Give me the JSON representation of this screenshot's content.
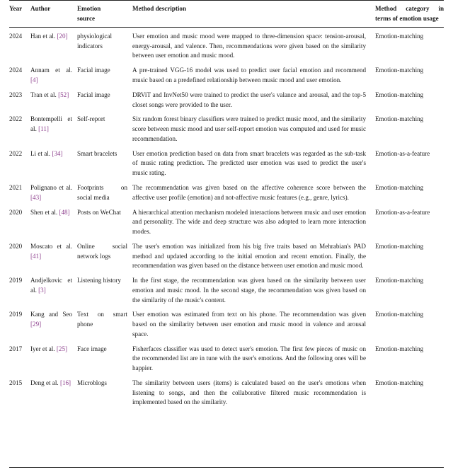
{
  "table": {
    "columns": [
      {
        "key": "year",
        "label": "Year"
      },
      {
        "key": "author",
        "label": "Author"
      },
      {
        "key": "source",
        "label": "Emotion source"
      },
      {
        "key": "method",
        "label": "Method description"
      },
      {
        "key": "category",
        "label": "Method category in terms of emotion usage"
      }
    ],
    "header": {
      "year": "Year",
      "author": "Author",
      "source_line1": "Emotion",
      "source_line2": "source",
      "method": "Method description",
      "category": "Method category in terms of emotion usage"
    },
    "citation_color": "#8d3f8d",
    "rule_color": "#222222",
    "rows": [
      {
        "year": "2024",
        "author_name": "Han et al.",
        "citation": "[20]",
        "cite_num": "20",
        "source": "physiological indicators",
        "method": "User emotion and music mood were mapped to three-dimension space: tension-arousal, energy-arousal, and valence. Then, recommendations were given based on the similarity between user emotion and music mood.",
        "category": "Emotion-matching"
      },
      {
        "year": "2024",
        "author_name": "Annam et al.",
        "citation": "[4]",
        "cite_num": "4",
        "source": "Facial image",
        "method": "A pre-trained VGG-16 model was used to predict user facial emotion and recommend music based on a predefined relationship between music mood and user emotion.",
        "category": "Emotion-matching"
      },
      {
        "year": "2023",
        "author_name": "Tran et al.",
        "citation": "[52]",
        "cite_num": "52",
        "source": "Facial image",
        "method": "DRViT and InvNet50 were trained to predict the user's valance and arousal, and the top-5 closet songs were provided to the user.",
        "category": "Emotion-matching"
      },
      {
        "year": "2022",
        "author_name": "Bontempelli et al.",
        "citation": "[11]",
        "cite_num": "11",
        "source": "Self-report",
        "method": "Six random forest binary classifiers were trained to predict music mood, and the similarity score between music mood and user self-report emotion was computed and used for music recommendation.",
        "category": "Emotion-matching"
      },
      {
        "year": "2022",
        "author_name": "Li et al.",
        "citation": "[34]",
        "cite_num": "34",
        "source": "Smart bracelets",
        "method": "User emotion prediction based on data from smart bracelets was regarded as the sub-task of music rating prediction. The predicted user emotion was used to predict the user's music rating.",
        "category": "Emotion-as-a-feature"
      },
      {
        "year": "2021",
        "author_name": "Polignano et al.",
        "citation": "[43]",
        "cite_num": "43",
        "source": "Footprints on social media",
        "method": "The recommendation was given based on the affective coherence score between the affective user profile (emotion) and not-affective music features (e.g., genre, lyrics).",
        "category": "Emotion-matching"
      },
      {
        "year": "2020",
        "author_name": "Shen et al.",
        "citation": "[48]",
        "cite_num": "48",
        "source": "Posts on WeChat",
        "method": "A hierarchical attention mechanism modeled interactions between music and user emotion and personality. The wide and deep structure was also adopted to learn more interaction modes.",
        "category": "Emotion-as-a-feature"
      },
      {
        "year": "2020",
        "author_name": "Moscato et al.",
        "citation": "[41]",
        "cite_num": "41",
        "source": "Online social network logs",
        "method": "The user's emotion was initialized from his big five traits based on Mehrabian's PAD method and updated according to the initial emotion and recent emotion. Finally, the recommendation was given based on the distance between user emotion and music mood.",
        "category": "Emotion-matching"
      },
      {
        "year": "2019",
        "author_name": "Andjelkovic et al.",
        "citation": "[3]",
        "cite_num": "3",
        "source": "Listening history",
        "method": "In the first stage, the recommendation was given based on the similarity between user emotion and music mood. In the second stage, the recommendation was given based on the similarity of the music's content.",
        "category": "Emotion-matching"
      },
      {
        "year": "2019",
        "author_name": "Kang and Seo",
        "citation": "[29]",
        "cite_num": "29",
        "source": "Text on smart phone",
        "method": "User emotion was estimated from text on his phone. The recommendation was given based on the similarity between user emotion and music mood in valence and arousal space.",
        "category": "Emotion-matching"
      },
      {
        "year": "2017",
        "author_name": "Iyer et al.",
        "citation": "[25]",
        "cite_num": "25",
        "source": "Face image",
        "method": "Fisherfaces classifier was used to detect user's emotion. The first few pieces of music on the recommended list are in tune with the user's emotions. And the following ones will be happier.",
        "category": "Emotion-matching"
      },
      {
        "year": "2015",
        "author_name": "Deng et al.",
        "citation": "[16]",
        "cite_num": "16",
        "source": "Microblogs",
        "method": "The similarity between users (items) is calculated based on the user's emotions when listening to songs, and then the collaborative filtered music recommendation is implemented based on the similarity.",
        "category": "Emotion-matching"
      }
    ]
  }
}
